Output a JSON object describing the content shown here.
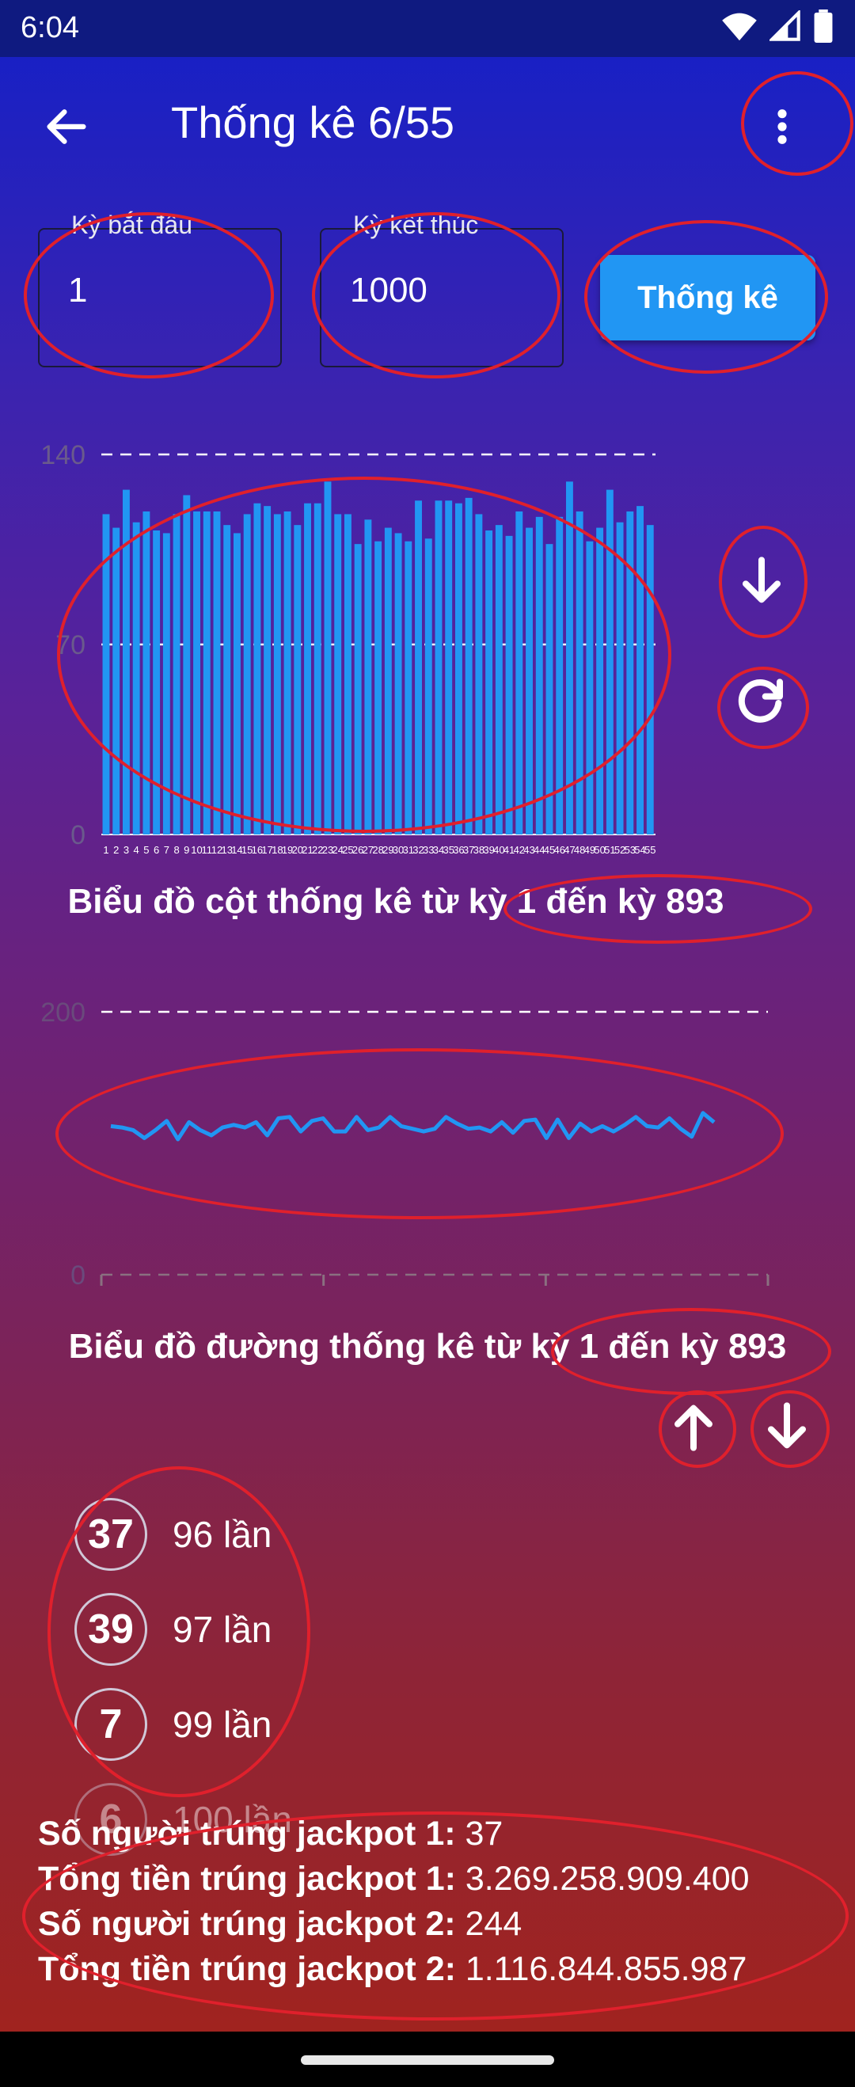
{
  "status": {
    "time": "6:04"
  },
  "toolbar": {
    "title": "Thống kê 6/55"
  },
  "form": {
    "start_label": "Kỳ bắt đầu",
    "start_value": "1",
    "end_label": "Kỳ kết thúc",
    "end_value": "1000",
    "submit_label": "Thống kê"
  },
  "bar_chart": {
    "caption": "Biểu đồ cột thống kê từ kỳ 1 đến kỳ  893",
    "y_ticks": [
      "140",
      "70",
      "0"
    ]
  },
  "line_chart": {
    "caption": "Biểu đồ đường thống kê từ kỳ 1 đến kỳ  893",
    "y_ticks": [
      "200",
      "0"
    ]
  },
  "chart_data": [
    {
      "type": "bar",
      "title": "Biểu đồ cột thống kê từ kỳ 1 đến kỳ  893",
      "categories": [
        "1",
        "2",
        "3",
        "4",
        "5",
        "6",
        "7",
        "8",
        "9",
        "10",
        "11",
        "12",
        "13",
        "14",
        "15",
        "16",
        "17",
        "18",
        "19",
        "20",
        "21",
        "22",
        "23",
        "24",
        "25",
        "26",
        "27",
        "28",
        "29",
        "30",
        "31",
        "32",
        "33",
        "34",
        "35",
        "36",
        "37",
        "38",
        "39",
        "40",
        "41",
        "42",
        "43",
        "44",
        "45",
        "46",
        "47",
        "48",
        "49",
        "50",
        "51",
        "52",
        "53",
        "54",
        "55"
      ],
      "values": [
        118,
        113,
        127,
        115,
        119,
        112,
        111,
        118,
        125,
        119,
        119,
        119,
        114,
        111,
        118,
        122,
        121,
        118,
        119,
        114,
        122,
        122,
        130,
        118,
        118,
        107,
        116,
        108,
        113,
        111,
        108,
        123,
        109,
        123,
        123,
        122,
        124,
        118,
        112,
        114,
        110,
        119,
        113,
        117,
        107,
        117,
        130,
        119,
        108,
        113,
        127,
        115,
        119,
        121,
        114
      ],
      "ylim": [
        0,
        140
      ],
      "grid": true
    },
    {
      "type": "line",
      "title": "Biểu đồ đường thống kê từ kỳ 1 đến kỳ  893",
      "values": [
        113,
        112,
        110,
        104,
        110,
        117,
        103,
        116,
        110,
        106,
        112,
        114,
        112,
        116,
        106,
        119,
        120,
        109,
        117,
        119,
        109,
        109,
        120,
        110,
        112,
        120,
        113,
        111,
        109,
        111,
        120,
        115,
        111,
        112,
        109,
        116,
        108,
        117,
        118,
        104,
        118,
        104,
        115,
        109,
        113,
        109,
        114,
        120,
        113,
        112,
        119,
        111,
        105,
        123,
        116
      ],
      "ylim": [
        0,
        200
      ],
      "grid": true
    }
  ],
  "frequency_list": [
    {
      "number": "37",
      "count": "96 lần"
    },
    {
      "number": "39",
      "count": "97 lần"
    },
    {
      "number": "7",
      "count": "99 lần"
    },
    {
      "number": "6",
      "count": "100 lần"
    }
  ],
  "summary": {
    "jackpot1_people_label": "Số người trúng jackpot 1:",
    "jackpot1_people_value": " 37",
    "jackpot1_money_label": "Tổng tiền trúng jackpot 1:",
    "jackpot1_money_value": " 3.269.258.909.400",
    "jackpot2_people_label": "Số người trúng jackpot 2:",
    "jackpot2_people_value": " 244",
    "jackpot2_money_label": "Tổng tiền trúng jackpot 2:",
    "jackpot2_money_value": " 1.116.844.855.987"
  },
  "colors": {
    "accent": "#2196f3",
    "highlight": "#e0202c"
  }
}
